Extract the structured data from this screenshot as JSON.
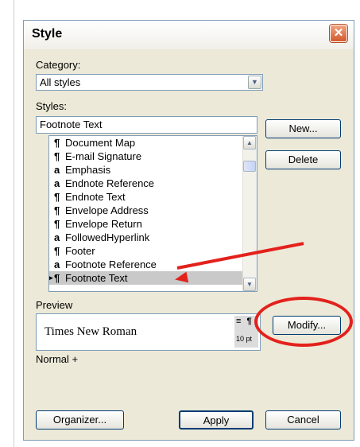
{
  "dialog": {
    "title": "Style",
    "close_label": "✕"
  },
  "category": {
    "label": "Category:",
    "selected": "All styles"
  },
  "styles": {
    "label": "Styles:",
    "input_value": "Footnote Text",
    "items": [
      {
        "glyph": "¶",
        "name": "Document Map"
      },
      {
        "glyph": "¶",
        "name": "E-mail Signature"
      },
      {
        "glyph": "a",
        "name": "Emphasis"
      },
      {
        "glyph": "a",
        "name": "Endnote Reference"
      },
      {
        "glyph": "¶",
        "name": "Endnote Text"
      },
      {
        "glyph": "¶",
        "name": "Envelope Address"
      },
      {
        "glyph": "¶",
        "name": "Envelope Return"
      },
      {
        "glyph": "a",
        "name": "FollowedHyperlink"
      },
      {
        "glyph": "¶",
        "name": "Footer"
      },
      {
        "glyph": "a",
        "name": "Footnote Reference"
      },
      {
        "glyph": "¶",
        "name": "Footnote Text"
      }
    ]
  },
  "buttons": {
    "new": "New...",
    "delete": "Delete",
    "modify": "Modify...",
    "organizer": "Organizer...",
    "apply": "Apply",
    "cancel": "Cancel"
  },
  "preview": {
    "label": "Preview",
    "font": "Times New Roman",
    "icons": "≡ ¶",
    "size": "10 pt",
    "description": "Normal +"
  },
  "annotation_color": "#e3211c"
}
